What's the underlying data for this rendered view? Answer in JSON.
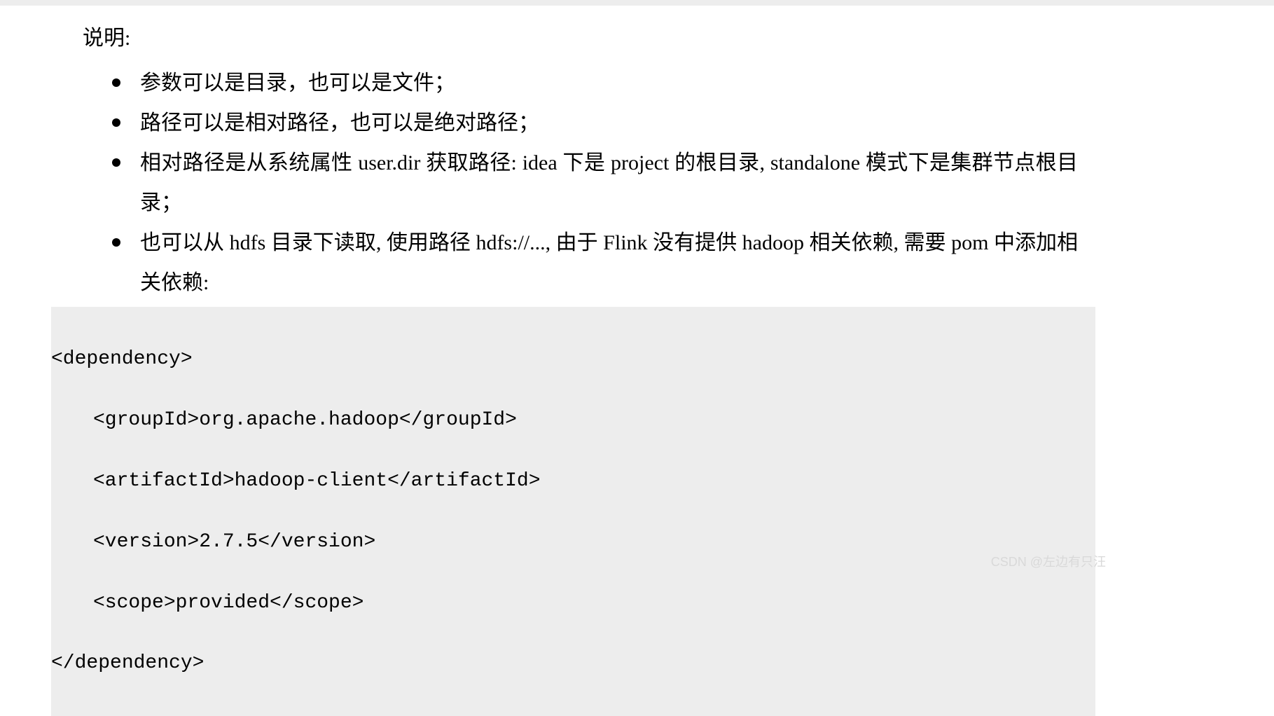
{
  "intro": "说明:",
  "bullets": [
    "参数可以是目录，也可以是文件；",
    "路径可以是相对路径，也可以是绝对路径；",
    "相对路径是从系统属性 user.dir 获取路径: idea 下是 project 的根目录, standalone 模式下是集群节点根目录；",
    "也可以从 hdfs 目录下读取, 使用路径 hdfs://..., 由于 Flink 没有提供 hadoop 相关依赖, 需要 pom 中添加相关依赖:"
  ],
  "code": {
    "l1": "<dependency>",
    "l2": "<groupId>org.apache.hadoop</groupId>",
    "l3": "<artifactId>hadoop-client</artifactId>",
    "l4": "<version>2.7.5</version>",
    "l5": "<scope>provided</scope>",
    "l6": "</dependency>"
  },
  "watermark": "CSDN @左边有只汪"
}
